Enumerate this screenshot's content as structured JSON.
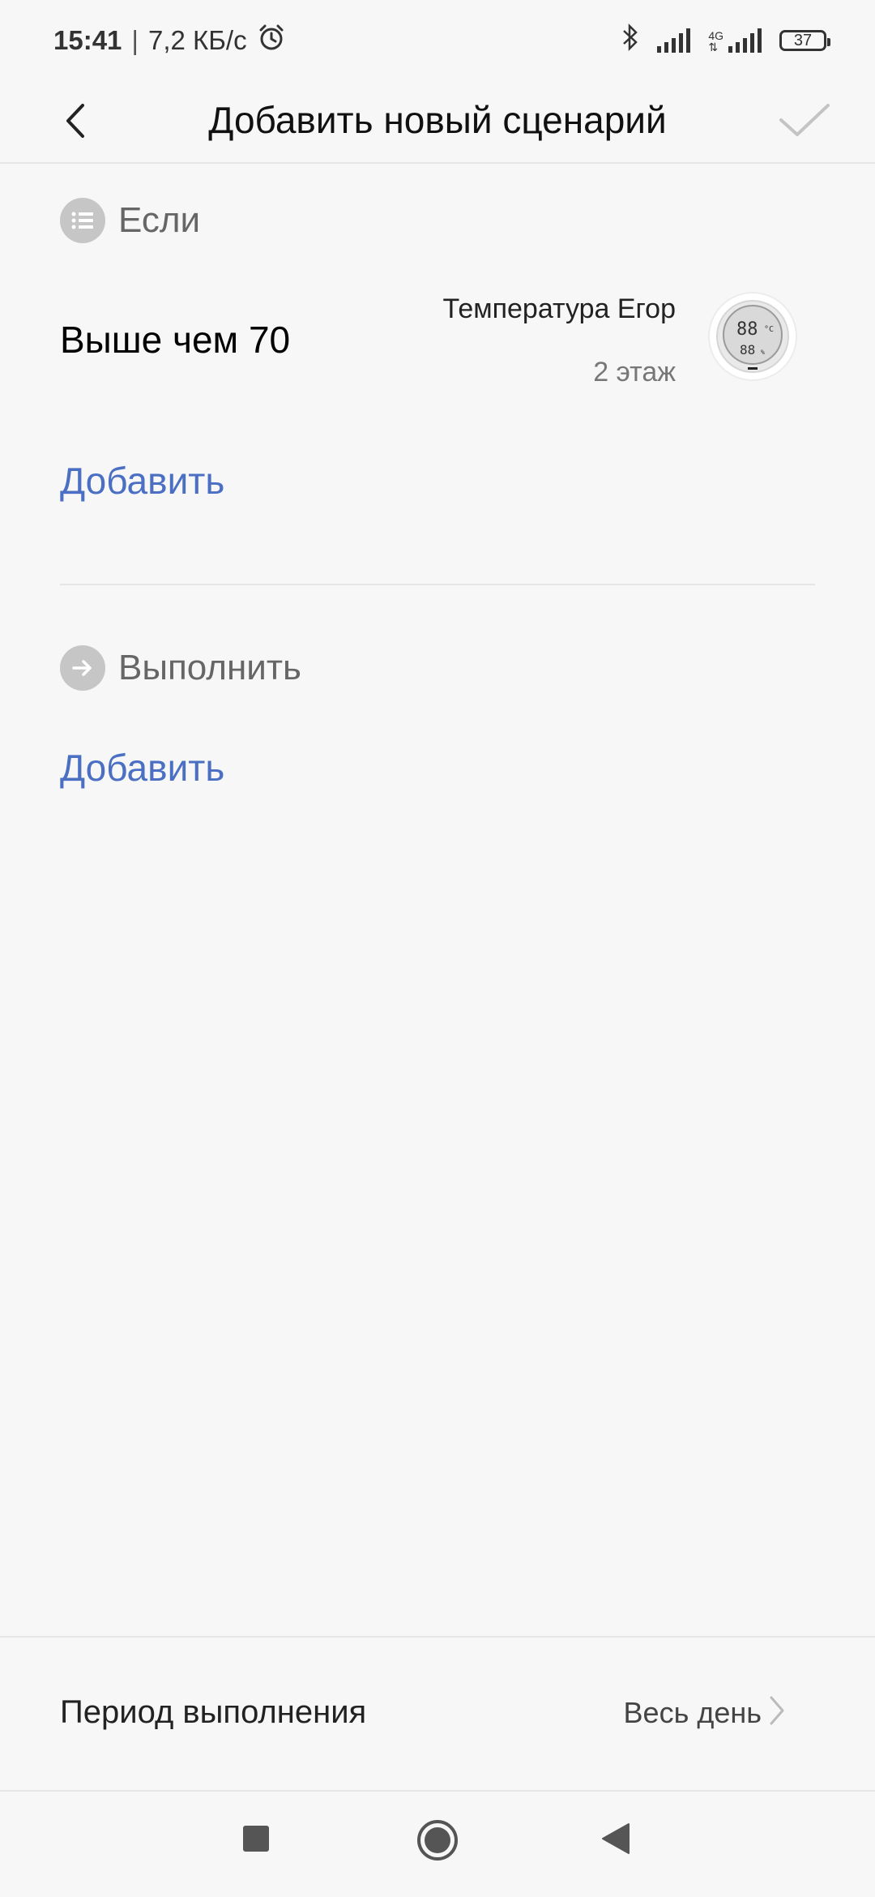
{
  "status_bar": {
    "time": "15:41",
    "separator": "|",
    "speed": "7,2 КБ/с",
    "network_type": "4G",
    "battery": "37"
  },
  "header": {
    "title": "Добавить новый сценарий"
  },
  "if_section": {
    "title": "Если",
    "condition": {
      "value": "Выше чем 70",
      "device_name": "Температура Егор",
      "device_room": "2 этаж"
    },
    "add_label": "Добавить"
  },
  "then_section": {
    "title": "Выполнить",
    "add_label": "Добавить"
  },
  "period": {
    "label": "Период выполнения",
    "value": "Весь день"
  },
  "colors": {
    "accent": "#4a6fc3",
    "icon_circle": "#c6c6c6",
    "background": "#f7f7f7"
  }
}
